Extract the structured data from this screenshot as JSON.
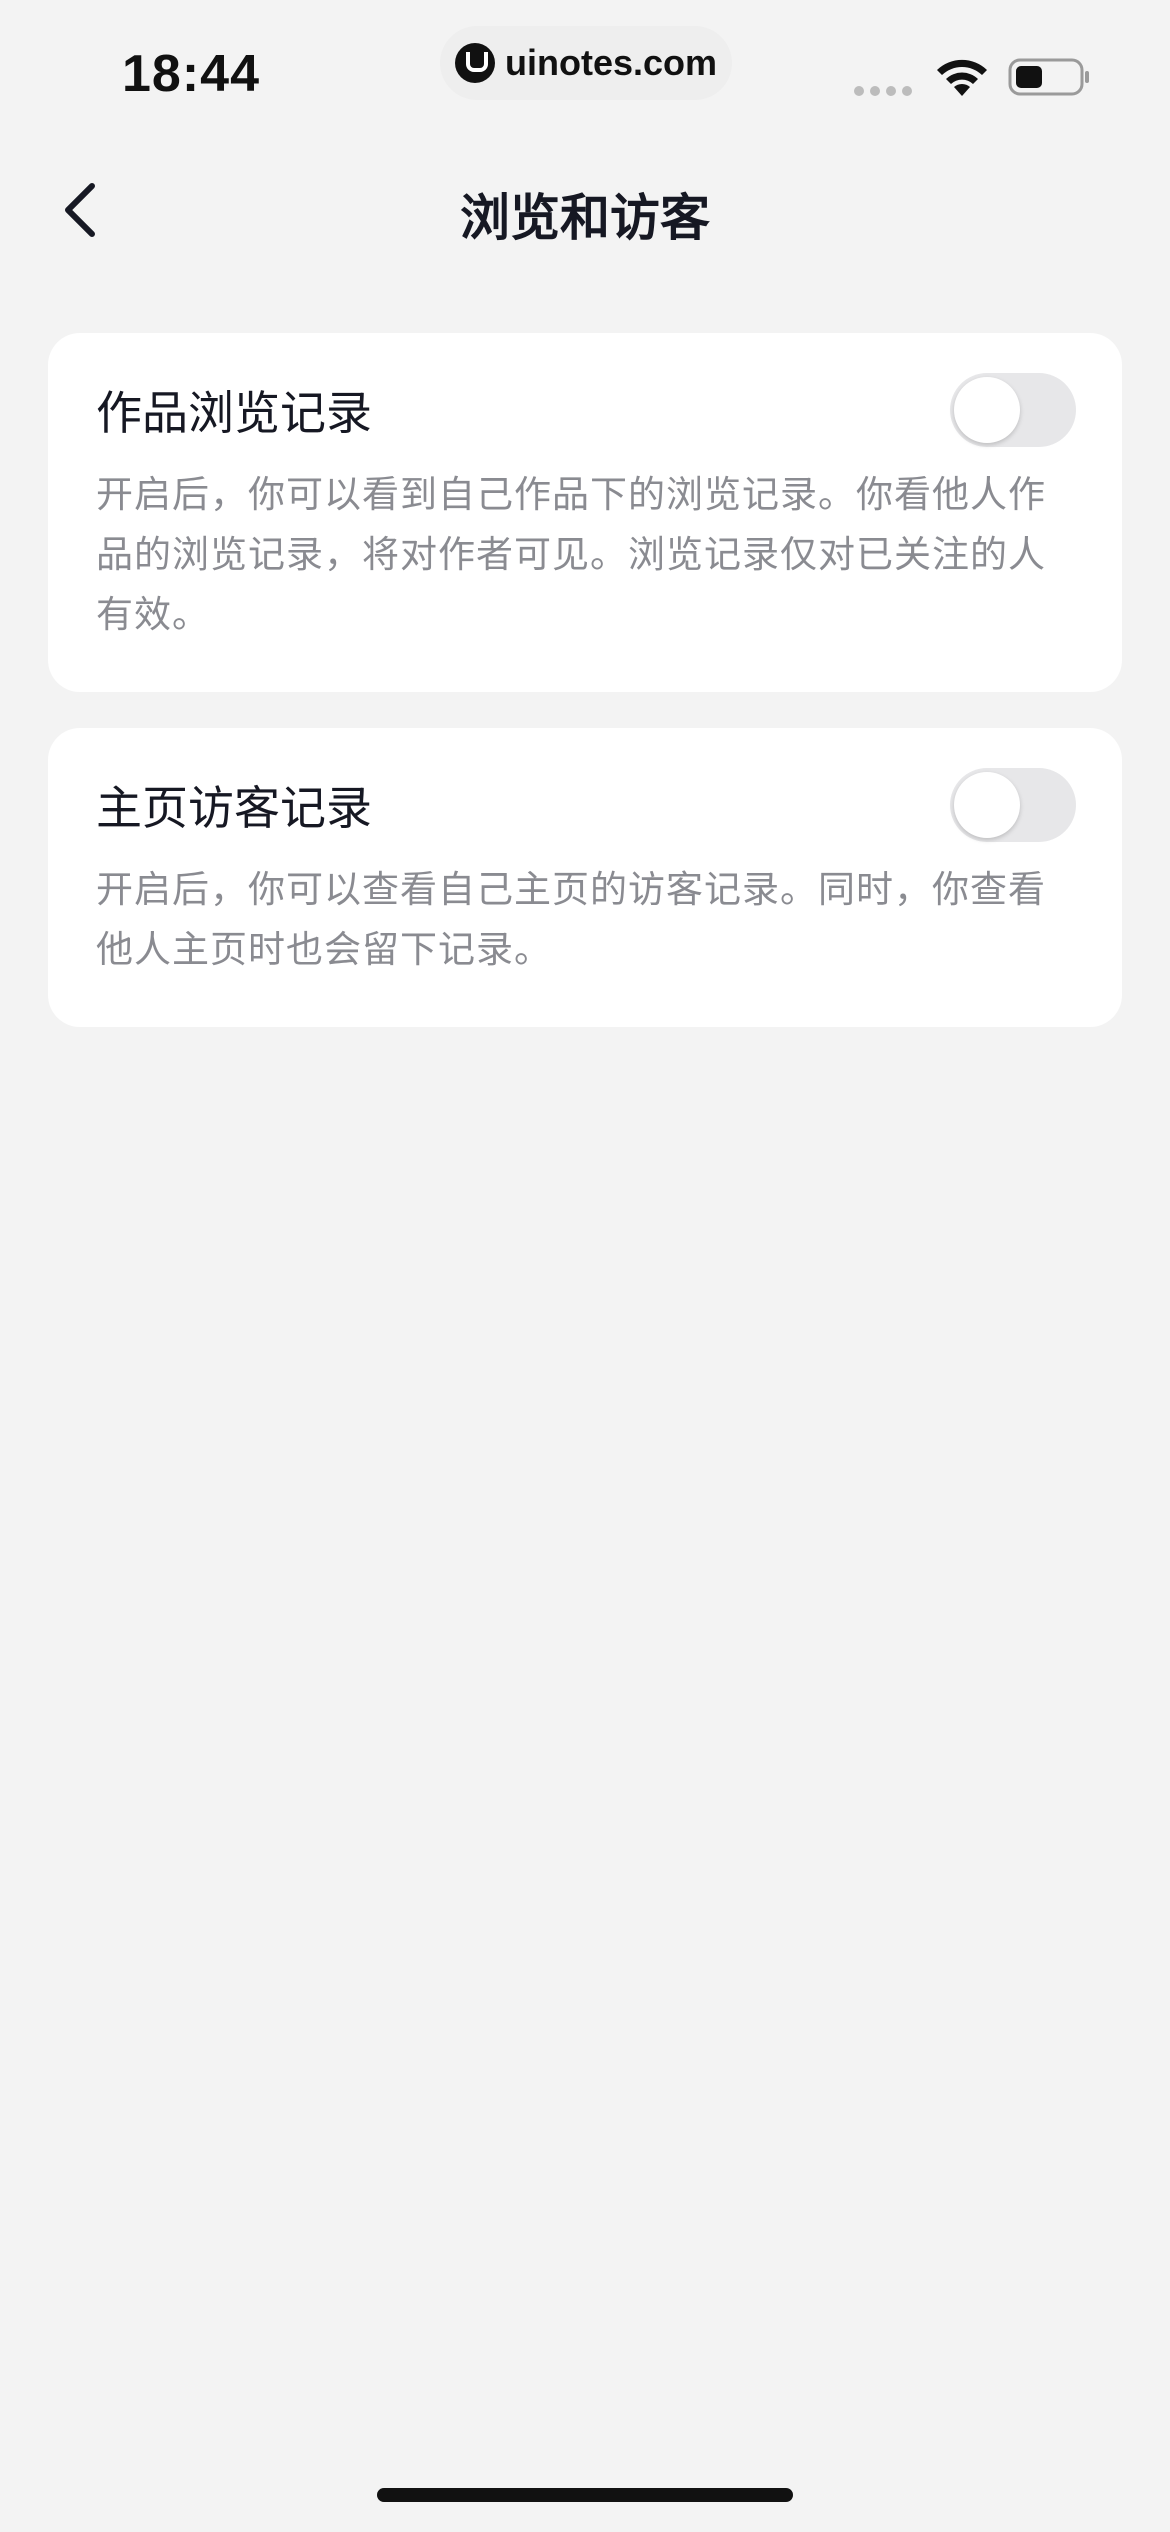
{
  "status_bar": {
    "time": "18:44",
    "url": "uinotes.com"
  },
  "nav": {
    "title": "浏览和访客"
  },
  "settings": [
    {
      "title": "作品浏览记录",
      "description": "开启后，你可以看到自己作品下的浏览记录。你看他人作品的浏览记录，将对作者可见。浏览记录仅对已关注的人有效。",
      "enabled": false
    },
    {
      "title": "主页访客记录",
      "description": "开启后，你可以查看自己主页的访客记录。同时，你查看他人主页时也会留下记录。",
      "enabled": false
    }
  ],
  "colors": {
    "background": "#f3f3f3",
    "card": "#ffffff",
    "title_text": "#161823",
    "desc_text": "#8a8b91",
    "toggle_off": "#e7e7e9"
  },
  "icons": {
    "back": "chevron-left-icon",
    "wifi": "wifi-icon",
    "battery": "battery-icon"
  }
}
